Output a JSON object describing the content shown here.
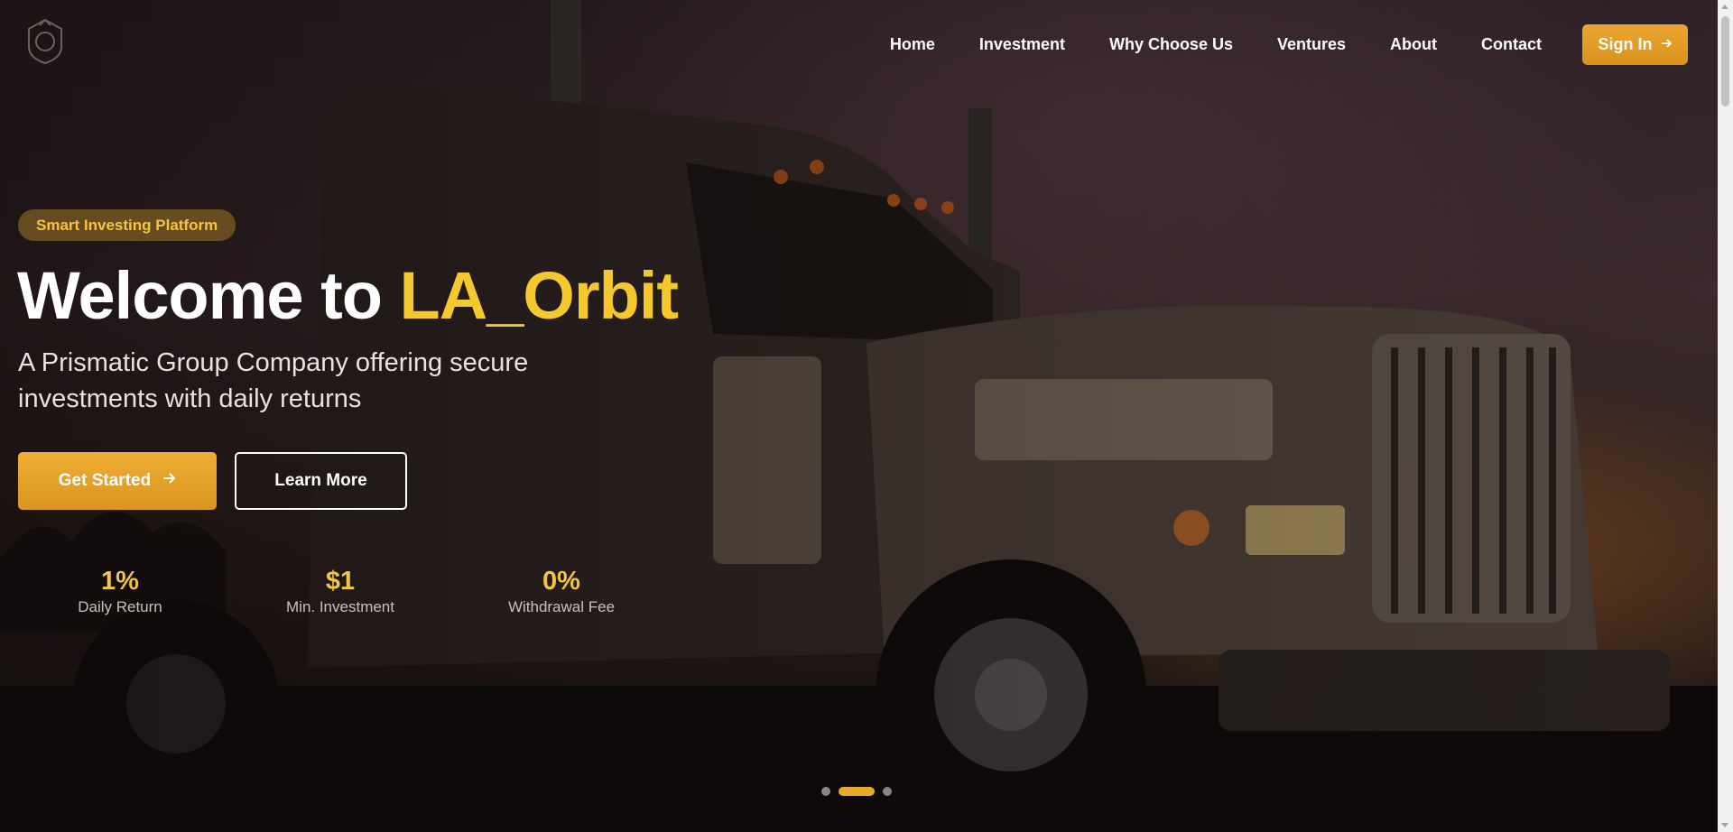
{
  "brand": {
    "logo_icon": "crest-logo-icon"
  },
  "nav": {
    "items": [
      "Home",
      "Investment",
      "Why Choose Us",
      "Ventures",
      "About",
      "Contact"
    ],
    "signin_label": "Sign In",
    "signin_icon": "arrow-right-icon"
  },
  "hero": {
    "badge": "Smart Investing Platform",
    "headline_prefix": "Welcome to ",
    "headline_brand": "LA_Orbit",
    "subtitle": "A Prismatic Group Company offering secure investments with daily returns",
    "primary_cta": "Get Started",
    "secondary_cta": "Learn More",
    "stats": [
      {
        "value": "1%",
        "label": "Daily Return"
      },
      {
        "value": "$1",
        "label": "Min. Investment"
      },
      {
        "value": "0%",
        "label": "Withdrawal Fee"
      }
    ],
    "slides": {
      "count": 3,
      "active_index": 1
    }
  },
  "colors": {
    "accent": "#E9A92A",
    "brand_text": "#F5C92E",
    "overlay": "#140E10"
  }
}
